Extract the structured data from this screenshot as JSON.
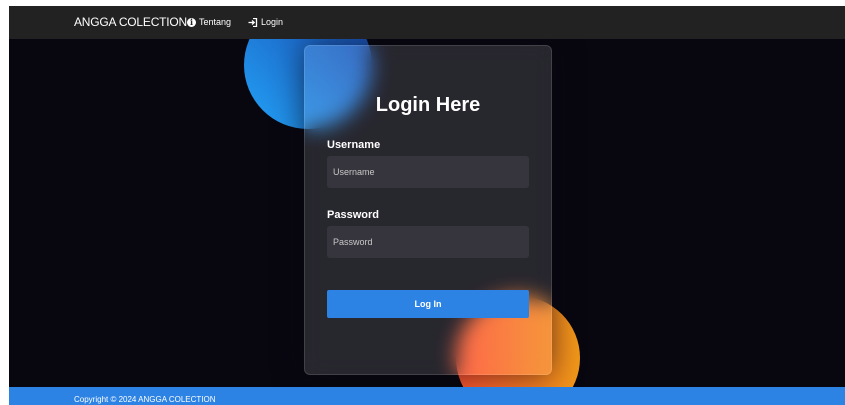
{
  "navbar": {
    "brand": "ANGGA COLECTION",
    "links": [
      {
        "label": "Tentang",
        "icon": "info-icon"
      },
      {
        "label": "Login",
        "icon": "login-icon"
      }
    ]
  },
  "login": {
    "title": "Login Here",
    "username_label": "Username",
    "username_placeholder": "Username",
    "password_label": "Password",
    "password_placeholder": "Password",
    "button_label": "Log In"
  },
  "footer": {
    "text": "Copyright © 2024 ANGGA COLECTION"
  },
  "colors": {
    "background": "#080710",
    "navbar": "#222222",
    "accent": "#2c83e4",
    "shape_blue": "#23a2f6",
    "shape_orange": "#ff512f"
  }
}
